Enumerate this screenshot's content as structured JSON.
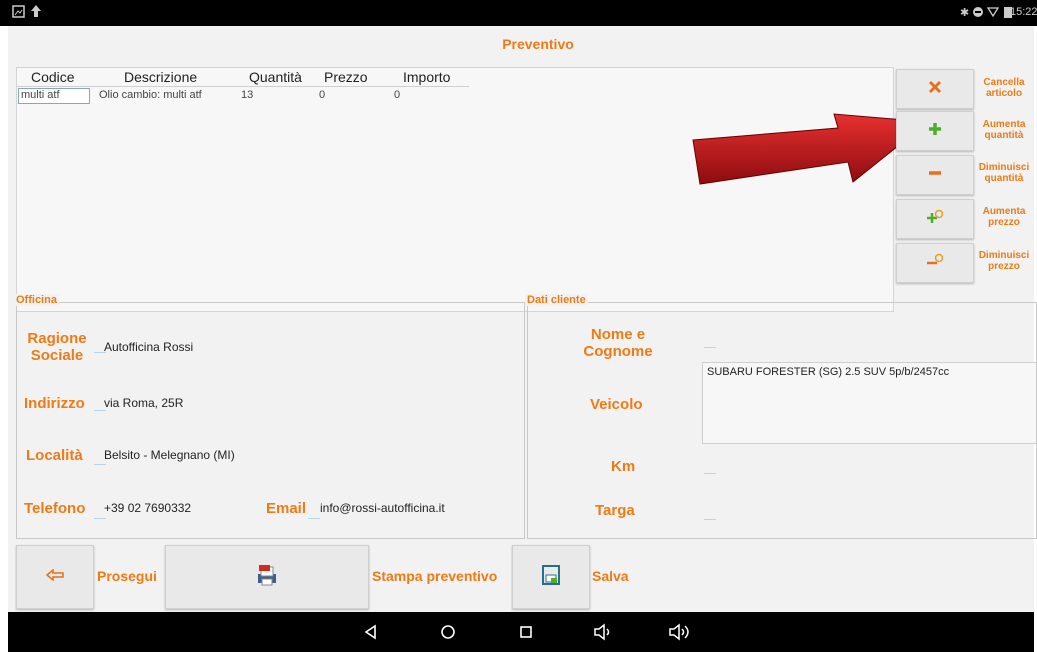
{
  "status_bar": {
    "time": "15:22"
  },
  "title": "Preventivo",
  "table": {
    "headers": [
      "Codice",
      "Descrizione",
      "Quantità",
      "Prezzo",
      "Importo"
    ],
    "rows": [
      [
        "multi atf",
        "Olio cambio: multi atf",
        "13",
        "0",
        "0"
      ]
    ]
  },
  "side_buttons": [
    {
      "label_line1": "Cancella",
      "label_line2": "articolo",
      "icon": "close-icon"
    },
    {
      "label_line1": "Aumenta",
      "label_line2": "quantità",
      "icon": "plus-icon"
    },
    {
      "label_line1": "Diminuisci",
      "label_line2": "quantità",
      "icon": "minus-icon"
    },
    {
      "label_line1": "Aumenta",
      "label_line2": "prezzo",
      "icon": "price-up-icon"
    },
    {
      "label_line1": "Diminuisci",
      "label_line2": "prezzo",
      "icon": "price-down-icon"
    }
  ],
  "officina": {
    "legend": "Officina",
    "ragione_label_1": "Ragione",
    "ragione_label_2": "Sociale",
    "ragione_value": "Autofficina Rossi",
    "indirizzo_label": "Indirizzo",
    "indirizzo_value": "via Roma, 25R",
    "localita_label": "Località",
    "localita_value": "Belsito - Melegnano (MI)",
    "telefono_label": "Telefono",
    "telefono_value": "+39 02 7690332",
    "email_label": "Email",
    "email_value": "info@rossi-autofficina.it"
  },
  "cliente": {
    "legend": "Dati cliente",
    "nome_label_1": "Nome e",
    "nome_label_2": "Cognome",
    "nome_value": "",
    "veicolo_label": "Veicolo",
    "veicolo_value": "SUBARU FORESTER (SG) 2.5 SUV 5p/b/2457cc",
    "km_label": "Km",
    "km_value": "",
    "targa_label": "Targa",
    "targa_value": ""
  },
  "bottom": {
    "prosegui": "Prosegui",
    "stampa": "Stampa preventivo",
    "salva": "Salva"
  },
  "colors": {
    "accent": "#f07a14",
    "arrow": "#c0141c"
  }
}
